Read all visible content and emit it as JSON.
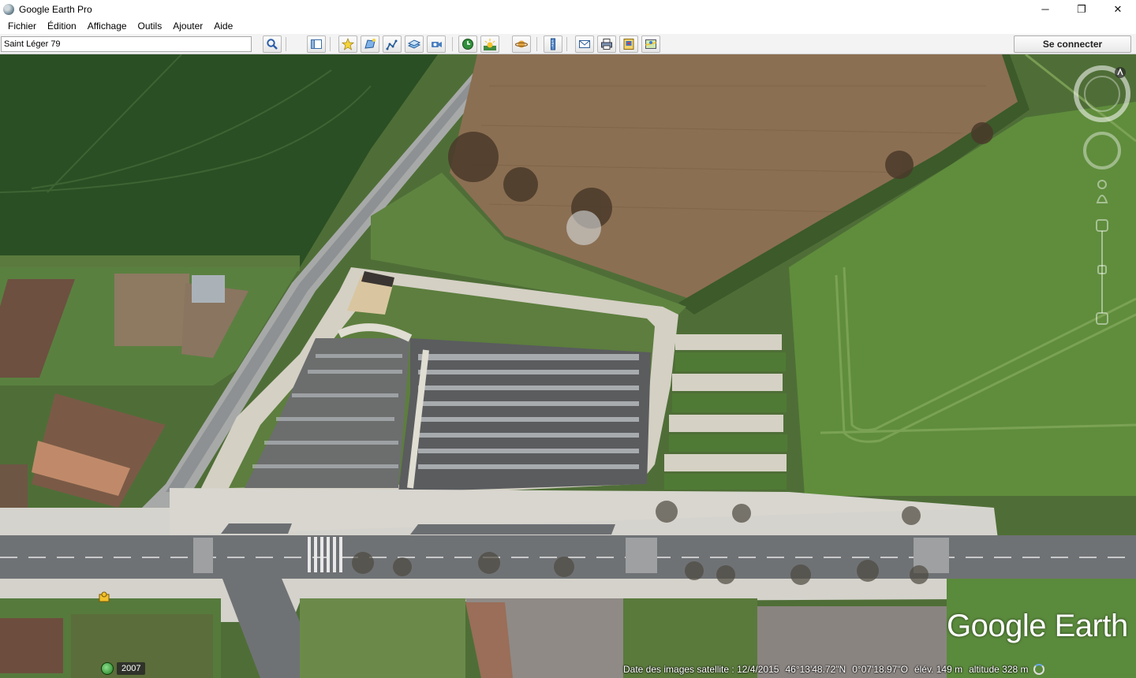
{
  "window": {
    "title": "Google Earth Pro",
    "minimize_glyph": "─",
    "restore_glyph": "❐",
    "close_glyph": "✕"
  },
  "menu": [
    {
      "label": "Fichier"
    },
    {
      "label": "Édition"
    },
    {
      "label": "Affichage"
    },
    {
      "label": "Outils"
    },
    {
      "label": "Ajouter"
    },
    {
      "label": "Aide"
    }
  ],
  "search": {
    "value": "Saint Léger 79"
  },
  "toolbar": {
    "connect_label": "Se connecter",
    "icons": [
      "search-icon",
      "sidebar-toggle-icon",
      "placemark-icon",
      "polygon-icon",
      "path-icon",
      "image-overlay-icon",
      "record-tour-icon",
      "historical-imagery-icon",
      "sunlight-icon",
      "planets-icon",
      "ruler-icon",
      "email-icon",
      "print-icon",
      "save-image-icon",
      "google-maps-icon"
    ]
  },
  "map": {
    "logo": "Google Earth",
    "historic_year": "2007",
    "status": {
      "imagery_date": "Date des images satellite : 12/4/2015",
      "latitude": "46°13'48.72\"N",
      "longitude": "0°07'18.97\"O",
      "elevation": "élév.  149 m",
      "altitude": "altitude    328 m"
    }
  },
  "colors": {
    "toolbar_bg": "#f3f3f3",
    "field_dark": "#2f5527",
    "field_brown": "#8a6e52",
    "road": "#7a7d80"
  }
}
